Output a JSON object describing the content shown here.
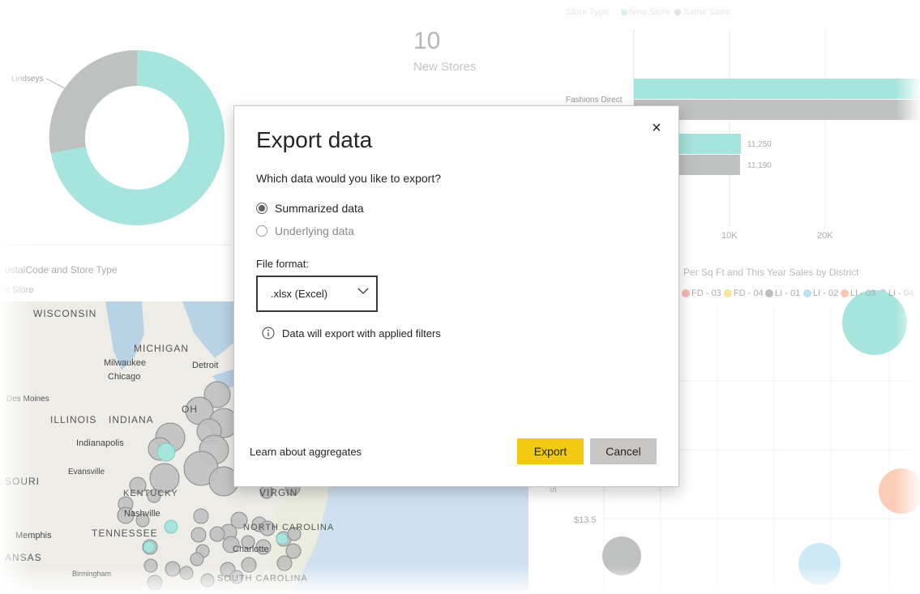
{
  "dialog": {
    "title": "Export data",
    "close_glyph": "×",
    "question": "Which data would you like to export?",
    "options": [
      {
        "label": "Summarized data",
        "selected": true,
        "enabled": true
      },
      {
        "label": "Underlying data",
        "selected": false,
        "enabled": false
      }
    ],
    "file_format_label": "File format:",
    "file_format_value": ".xlsx (Excel)",
    "info_text": "Data will export with applied filters",
    "learn_link": "Learn about aggregates",
    "export_label": "Export",
    "cancel_label": "Cancel",
    "accent_color": "#F2C811"
  },
  "background": {
    "card": {
      "value": "10",
      "label": "New Stores"
    },
    "donut_label": "Lindseys",
    "bar_chart": {
      "legend_title": "Store Type",
      "legend_items": [
        "New Store",
        "Same Store"
      ],
      "category": "Fashions Direct",
      "values": [
        "11,250",
        "11,190"
      ],
      "ticks": [
        "10K",
        "20K"
      ]
    },
    "map_title": "ostalCode and Store Type",
    "map_legend": "e Store",
    "map_labels": [
      "WISCONSIN",
      "MICHIGAN",
      "Milwaukee",
      "Detroit",
      "Chicago",
      "Des Moines",
      "ILLINOIS",
      "INDIANA",
      "OH",
      "Indianapolis",
      "Evansville",
      "SOURI",
      "KENTUCKY",
      "Nashville",
      "TENNESSEE",
      "Memphis",
      "ANSAS",
      "Birmingham",
      "VIRGIN",
      "NORTH CAROLINA",
      "Charlotte",
      "SOUTH CAROLINA"
    ],
    "scatter_title": "Per Sq Ft and This Year Sales by District",
    "scatter_legend": [
      "FD - 03",
      "FD - 04",
      "LI - 01",
      "LI - 02",
      "LI - 03",
      "LI - 04"
    ],
    "scatter_axis": "Sales P",
    "scatter_ytick": "$13.5",
    "colors": {
      "new_store": "#A6E4DE",
      "same_store": "#BFC1C0"
    }
  }
}
